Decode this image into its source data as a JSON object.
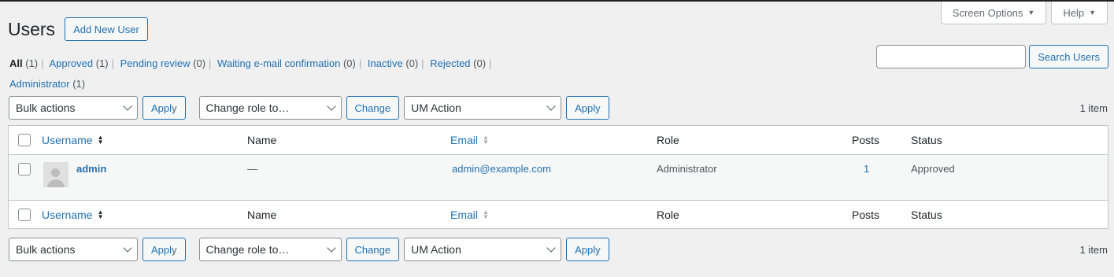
{
  "screen_meta": {
    "screen_options": "Screen Options",
    "help": "Help"
  },
  "page": {
    "title": "Users",
    "add_new": "Add New User"
  },
  "filters": [
    {
      "label": "All",
      "count": "(1)",
      "current": true
    },
    {
      "label": "Approved",
      "count": "(1)"
    },
    {
      "label": "Pending review",
      "count": "(0)"
    },
    {
      "label": "Waiting e-mail confirmation",
      "count": "(0)"
    },
    {
      "label": "Inactive",
      "count": "(0)"
    },
    {
      "label": "Rejected",
      "count": "(0)"
    },
    {
      "label": "Administrator",
      "count": "(1)"
    }
  ],
  "search": {
    "value": "",
    "button": "Search Users"
  },
  "tablenav": {
    "bulk_actions": "Bulk actions",
    "apply": "Apply",
    "change_role": "Change role to…",
    "change": "Change",
    "um_action": "UM Action",
    "items_count": "1 item"
  },
  "table": {
    "columns": {
      "username": "Username",
      "name": "Name",
      "email": "Email",
      "role": "Role",
      "posts": "Posts",
      "status": "Status"
    },
    "rows": [
      {
        "username": "admin",
        "name": "—",
        "email": "admin@example.com",
        "role": "Administrator",
        "posts": "1",
        "status": "Approved"
      }
    ]
  },
  "colors": {
    "link": "#2271b1",
    "background": "#f0f0f1",
    "text": "#3c434a"
  }
}
